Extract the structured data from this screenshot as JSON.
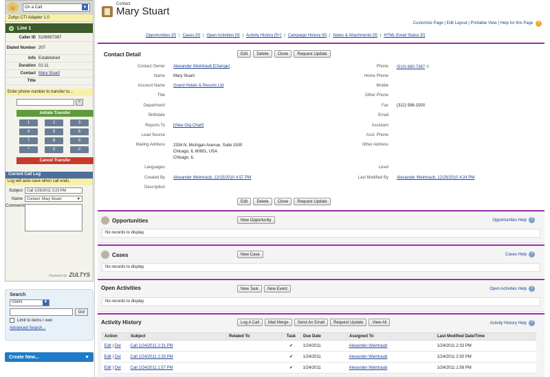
{
  "cti": {
    "status": "On a Call",
    "adapter": "Zultys CTI Adapter 1.0",
    "line": "Line 1",
    "fields": [
      {
        "label": "Caller ID",
        "value": "5106907387"
      },
      {
        "label": "Dialed Number",
        "value": "207"
      },
      {
        "label": "Info",
        "value": "Established"
      },
      {
        "label": "Duration",
        "value": "01:11"
      },
      {
        "label": "Contact",
        "value": "Mary Stuart"
      },
      {
        "label": "Title",
        "value": ""
      }
    ],
    "transfer_prompt": "Enter phone number to transfer to...",
    "initiate_transfer": "Initiate Transfer",
    "keys": [
      "1",
      "2",
      "3",
      "4",
      "5",
      "6",
      "7",
      "8",
      "9",
      "*",
      "0",
      "#"
    ],
    "cancel_transfer": "Cancel Transfer",
    "log_header": "Current Call Log",
    "log_note": "Log will auto-save when call ends.",
    "subject_label": "Subject",
    "subject_value": "Call 1/25/2011 3:23 PM",
    "name_label": "Name",
    "name_value": "Contact: Mary Stuart",
    "comments_label": "Comments",
    "powered_by": "Powered by",
    "brand": "ZULTYS"
  },
  "search": {
    "title": "Search",
    "scope": "Users",
    "go": "Go!",
    "limit_label": "Limit to items I own",
    "advanced": "Advanced Search..."
  },
  "create_new": "Create New...",
  "header": {
    "type": "Contact",
    "name": "Mary Stuart",
    "links": "Customize Page | Edit Layout | Printable View | Help for this Page"
  },
  "sublinks": [
    "Opportunities [0]",
    "|",
    "Cases [0]",
    "|",
    "Open Activities [0]",
    "|",
    "Activity History [5+]",
    "|",
    "Campaign History [0]",
    "|",
    "Notes & Attachments [0]",
    "|",
    "HTML Email Status [0]"
  ],
  "detail": {
    "title": "Contact Detail",
    "buttons": [
      "Edit",
      "Delete",
      "Clone",
      "Request Update"
    ],
    "rows": [
      {
        "l1": "Contact Owner",
        "v1": "Alexander Weintraub [Change]",
        "l2": "Phone",
        "v2": "(510) 690-7387"
      },
      {
        "l1": "Name",
        "v1": "Mary Stuart",
        "l2": "Home Phone",
        "v2": ""
      },
      {
        "l1": "Account Name",
        "v1": "Grand Hotels & Resorts Ltd",
        "l2": "Mobile",
        "v2": ""
      },
      {
        "l1": "Title",
        "v1": "",
        "l2": "Other Phone",
        "v2": ""
      },
      {
        "l1": "Department",
        "v1": "",
        "l2": "Fax",
        "v2": "(312) 596-1500"
      },
      {
        "l1": "Birthdate",
        "v1": "",
        "l2": "Email",
        "v2": ""
      },
      {
        "l1": "Reports To",
        "v1": "[View Org Chart]",
        "l2": "Assistant",
        "v2": ""
      },
      {
        "l1": "Lead Source",
        "v1": "",
        "l2": "Asst. Phone",
        "v2": ""
      },
      {
        "l1": "Mailing Address",
        "v1": "2334 N. Michigan Avenue, Suite 1500\nChicago, IL 60601, USA\nChicago, IL",
        "l2": "Other Address",
        "v2": ""
      },
      {
        "l1": "Languages",
        "v1": "",
        "l2": "Level",
        "v2": ""
      },
      {
        "l1": "Created By",
        "v1": "Alexander Weintraub, 12/15/2010 4:57 PM",
        "l2": "Last Modified By",
        "v2": "Alexander Weintraub, 12/29/2010 4:24 PM"
      },
      {
        "l1": "Description",
        "v1": "",
        "l2": "",
        "v2": ""
      }
    ]
  },
  "opportunities": {
    "title": "Opportunities",
    "button": "New Opportunity",
    "help": "Opportunities Help",
    "empty": "No records to display"
  },
  "cases": {
    "title": "Cases",
    "button": "New Case",
    "help": "Cases Help",
    "empty": "No records to display"
  },
  "open_activities": {
    "title": "Open Activities",
    "buttons": [
      "New Task",
      "New Event"
    ],
    "help": "Open Activities Help",
    "empty": "No records to display"
  },
  "activity_history": {
    "title": "Activity History",
    "buttons": [
      "Log A Call",
      "Mail Merge",
      "Send An Email",
      "Request Update",
      "View All"
    ],
    "help": "Activity History Help",
    "columns": [
      "Action",
      "Subject",
      "Related To",
      "Task",
      "Due Date",
      "Assigned To",
      "Last Modified Date/Time"
    ],
    "rows": [
      {
        "action_edit": "Edit",
        "action_del": "Del",
        "subject": "Call 1/24/2011 2:31 PM",
        "related": "",
        "task": "✔",
        "due": "1/24/2011",
        "assigned": "Alexander Weintraub",
        "modified": "1/24/2011 2:33 PM"
      },
      {
        "action_edit": "Edit",
        "action_del": "Del",
        "subject": "Call 1/24/2011 2:28 PM",
        "related": "",
        "task": "✔",
        "due": "1/24/2011",
        "assigned": "Alexander Weintraub",
        "modified": "1/24/2011 2:30 PM"
      },
      {
        "action_edit": "Edit",
        "action_del": "Del",
        "subject": "Call 1/24/2011 1:57 PM",
        "related": "",
        "task": "✔",
        "due": "1/24/2011",
        "assigned": "Alexander Weintraub",
        "modified": "1/24/2011 1:58 PM"
      }
    ]
  }
}
